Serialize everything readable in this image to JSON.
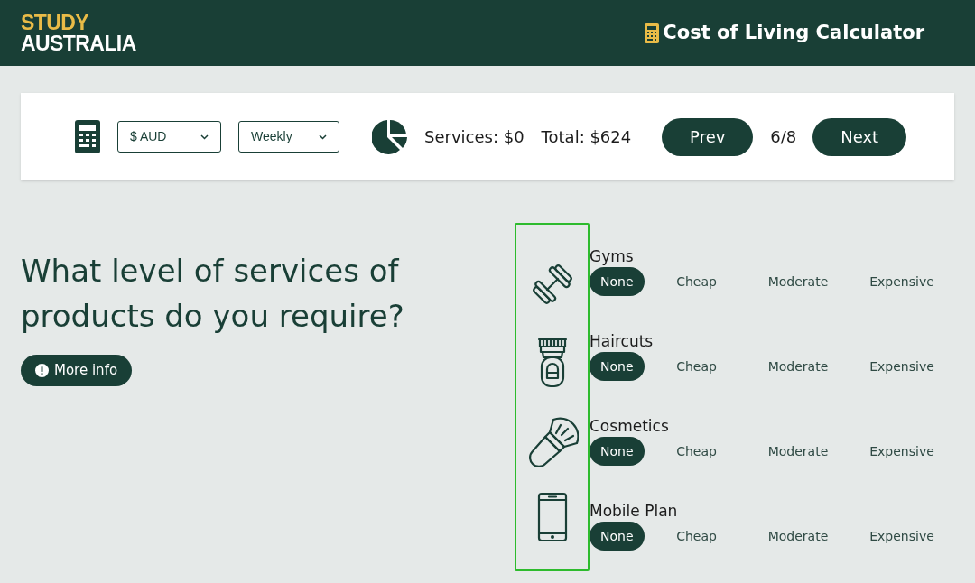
{
  "header": {
    "logo_top": "STUDY",
    "logo_bottom": "AUSTRALIA",
    "title": "Cost of Living Calculator"
  },
  "toolbar": {
    "currency": "$ AUD",
    "period": "Weekly",
    "services_total": "Services: $0",
    "total": "Total: $624",
    "prev": "Prev",
    "step": "6/8",
    "next": "Next"
  },
  "question": {
    "heading": "What level of services of products do you require?",
    "more_info": "More info"
  },
  "services": [
    {
      "kind": "gym",
      "label": "Gyms",
      "options": [
        {
          "label": "None",
          "selected": true
        },
        {
          "label": "Cheap",
          "selected": false
        },
        {
          "label": "Moderate",
          "selected": false
        },
        {
          "label": "Expensive",
          "selected": false
        }
      ]
    },
    {
      "kind": "haircut",
      "label": "Haircuts",
      "options": [
        {
          "label": "None",
          "selected": true
        },
        {
          "label": "Cheap",
          "selected": false
        },
        {
          "label": "Moderate",
          "selected": false
        },
        {
          "label": "Expensive",
          "selected": false
        }
      ]
    },
    {
      "kind": "cosmetics",
      "label": "Cosmetics",
      "options": [
        {
          "label": "None",
          "selected": true
        },
        {
          "label": "Cheap",
          "selected": false
        },
        {
          "label": "Moderate",
          "selected": false
        },
        {
          "label": "Expensive",
          "selected": false
        }
      ]
    },
    {
      "kind": "mobile",
      "label": "Mobile Plan",
      "options": [
        {
          "label": "None",
          "selected": true
        },
        {
          "label": "Cheap",
          "selected": false
        },
        {
          "label": "Moderate",
          "selected": false
        },
        {
          "label": "Expensive",
          "selected": false
        }
      ]
    }
  ]
}
